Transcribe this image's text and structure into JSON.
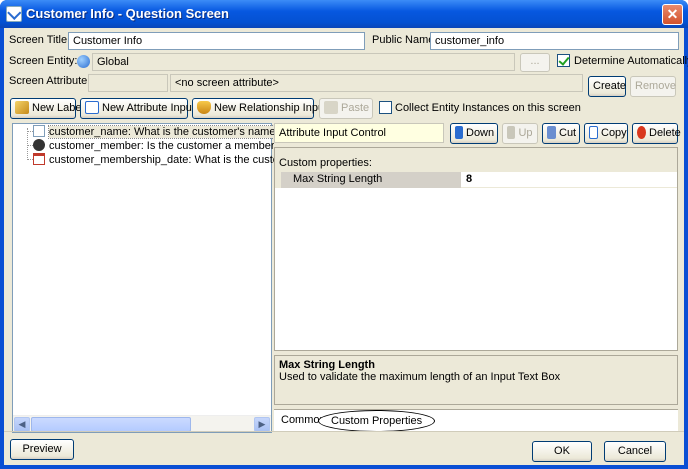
{
  "window": {
    "title": "Customer Info - Question Screen",
    "close_glyph": "✕"
  },
  "form": {
    "screen_title_label": "Screen Title:",
    "screen_title_value": "Customer Info",
    "public_name_label": "Public Name:",
    "public_name_value": "customer_info",
    "screen_entity_label": "Screen Entity:",
    "screen_entity_value": "Global",
    "entity_browse_label": "...",
    "determine_auto_label": "Determine Automatically",
    "determine_auto_checked": true,
    "screen_attribute_label": "Screen Attribute:",
    "screen_attribute_value": "<no screen attribute>",
    "create_label": "Create",
    "remove_label": "Remove"
  },
  "toolbar": {
    "new_label": "New Label",
    "new_attribute_input": "New Attribute Input",
    "new_relationship_input": "New Relationship Input",
    "paste": "Paste",
    "collect_label": "Collect Entity Instances on this screen",
    "collect_checked": false
  },
  "tree": {
    "items": [
      {
        "text": "customer_name: What is the customer's name?",
        "icon": "text-field-icon"
      },
      {
        "text": "customer_member: Is the customer a member of the airl",
        "icon": "boolean-icon"
      },
      {
        "text": "customer_membership_date: What is the customer's air",
        "icon": "calendar-icon"
      }
    ]
  },
  "right": {
    "control_type": "Attribute Input Control",
    "down": "Down",
    "up": "Up",
    "cut": "Cut",
    "copy": "Copy",
    "delete": "Delete",
    "custom_properties_header": "Custom properties:",
    "property_name": "Max String Length",
    "property_value": "8",
    "desc_title": "Max String Length",
    "desc_text": "Used to validate the maximum length of an Input Text Box",
    "tab_common": "Common",
    "tab_custom": "Custom Properties"
  },
  "footer": {
    "preview": "Preview",
    "ok": "OK",
    "cancel": "Cancel"
  },
  "colors": {
    "titlebar": "#0758e0",
    "dialog_bg": "#ece9d8",
    "close": "#d3522c"
  }
}
